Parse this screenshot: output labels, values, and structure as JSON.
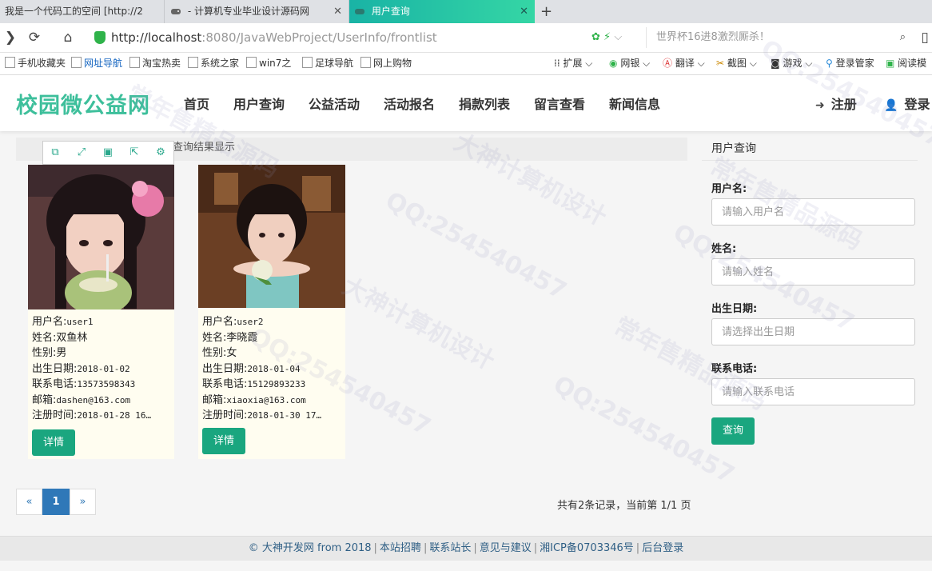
{
  "browser": {
    "tabs": [
      {
        "label": "我是一个代码工的空间 [http://2"
      },
      {
        "label": "- 计算机专业毕业设计源码网"
      },
      {
        "label": "用户查询"
      }
    ],
    "url_host": "http://localhost",
    "url_path": ":8080/JavaWebProject/UserInfo/frontlist",
    "search_text": "世界杯16进8激烈厮杀！",
    "bookmarks": [
      "手机收藏夹",
      "网址导航",
      "淘宝热卖",
      "系统之家",
      "win7之",
      "足球导航",
      "网上购物",
      "扩展",
      "网银",
      "翻译",
      "截图",
      "游戏",
      "登录管家",
      "阅读模"
    ]
  },
  "site": {
    "logo": "校园微公益网",
    "nav": [
      "首页",
      "用户查询",
      "公益活动",
      "活动报名",
      "捐款列表",
      "留言查看",
      "新闻信息"
    ],
    "register": "注册",
    "login": "登录"
  },
  "results": {
    "title": "查询结果显示",
    "users": [
      {
        "username_label": "用户名:",
        "username": "user1",
        "name_label": "姓名:",
        "name": "双鱼林",
        "gender_label": "性别:",
        "gender": "男",
        "birth_label": "出生日期:",
        "birth": "2018-01-02",
        "phone_label": "联系电话:",
        "phone": "13573598343",
        "email_label": "邮箱:",
        "email": "dashen@163.com",
        "reg_label": "注册时间:",
        "reg": "2018-01-28 16…",
        "detail": "详情"
      },
      {
        "username_label": "用户名:",
        "username": "user2",
        "name_label": "姓名:",
        "name": "李晓霞",
        "gender_label": "性别:",
        "gender": "女",
        "birth_label": "出生日期:",
        "birth": "2018-01-04",
        "phone_label": "联系电话:",
        "phone": "15129893233",
        "email_label": "邮箱:",
        "email": "xiaoxia@163.com",
        "reg_label": "注册时间:",
        "reg": "2018-01-30 17…",
        "detail": "详情"
      }
    ]
  },
  "query": {
    "title": "用户查询",
    "username_label": "用户名:",
    "username_placeholder": "请输入用户名",
    "name_label": "姓名:",
    "name_placeholder": "请输入姓名",
    "birth_label": "出生日期:",
    "birth_placeholder": "请选择出生日期",
    "phone_label": "联系电话:",
    "phone_placeholder": "请输入联系电话",
    "submit": "查询"
  },
  "pagination": {
    "prev": "«",
    "current": "1",
    "next": "»",
    "summary": "共有2条记录，当前第 1/1 页"
  },
  "footer": [
    "© 大神开发网 from 2018",
    "本站招聘",
    "联系站长",
    "意见与建议",
    "湘ICP备0703346号",
    "后台登录"
  ],
  "watermarks": [
    "QQ:254540457",
    "大神计算机设计",
    "常年售精品源码"
  ],
  "colors": {
    "accent": "#1aa67f",
    "logo": "#3dbf9b",
    "page_active": "#2f78b8",
    "tab_active": "#19b3a5"
  }
}
